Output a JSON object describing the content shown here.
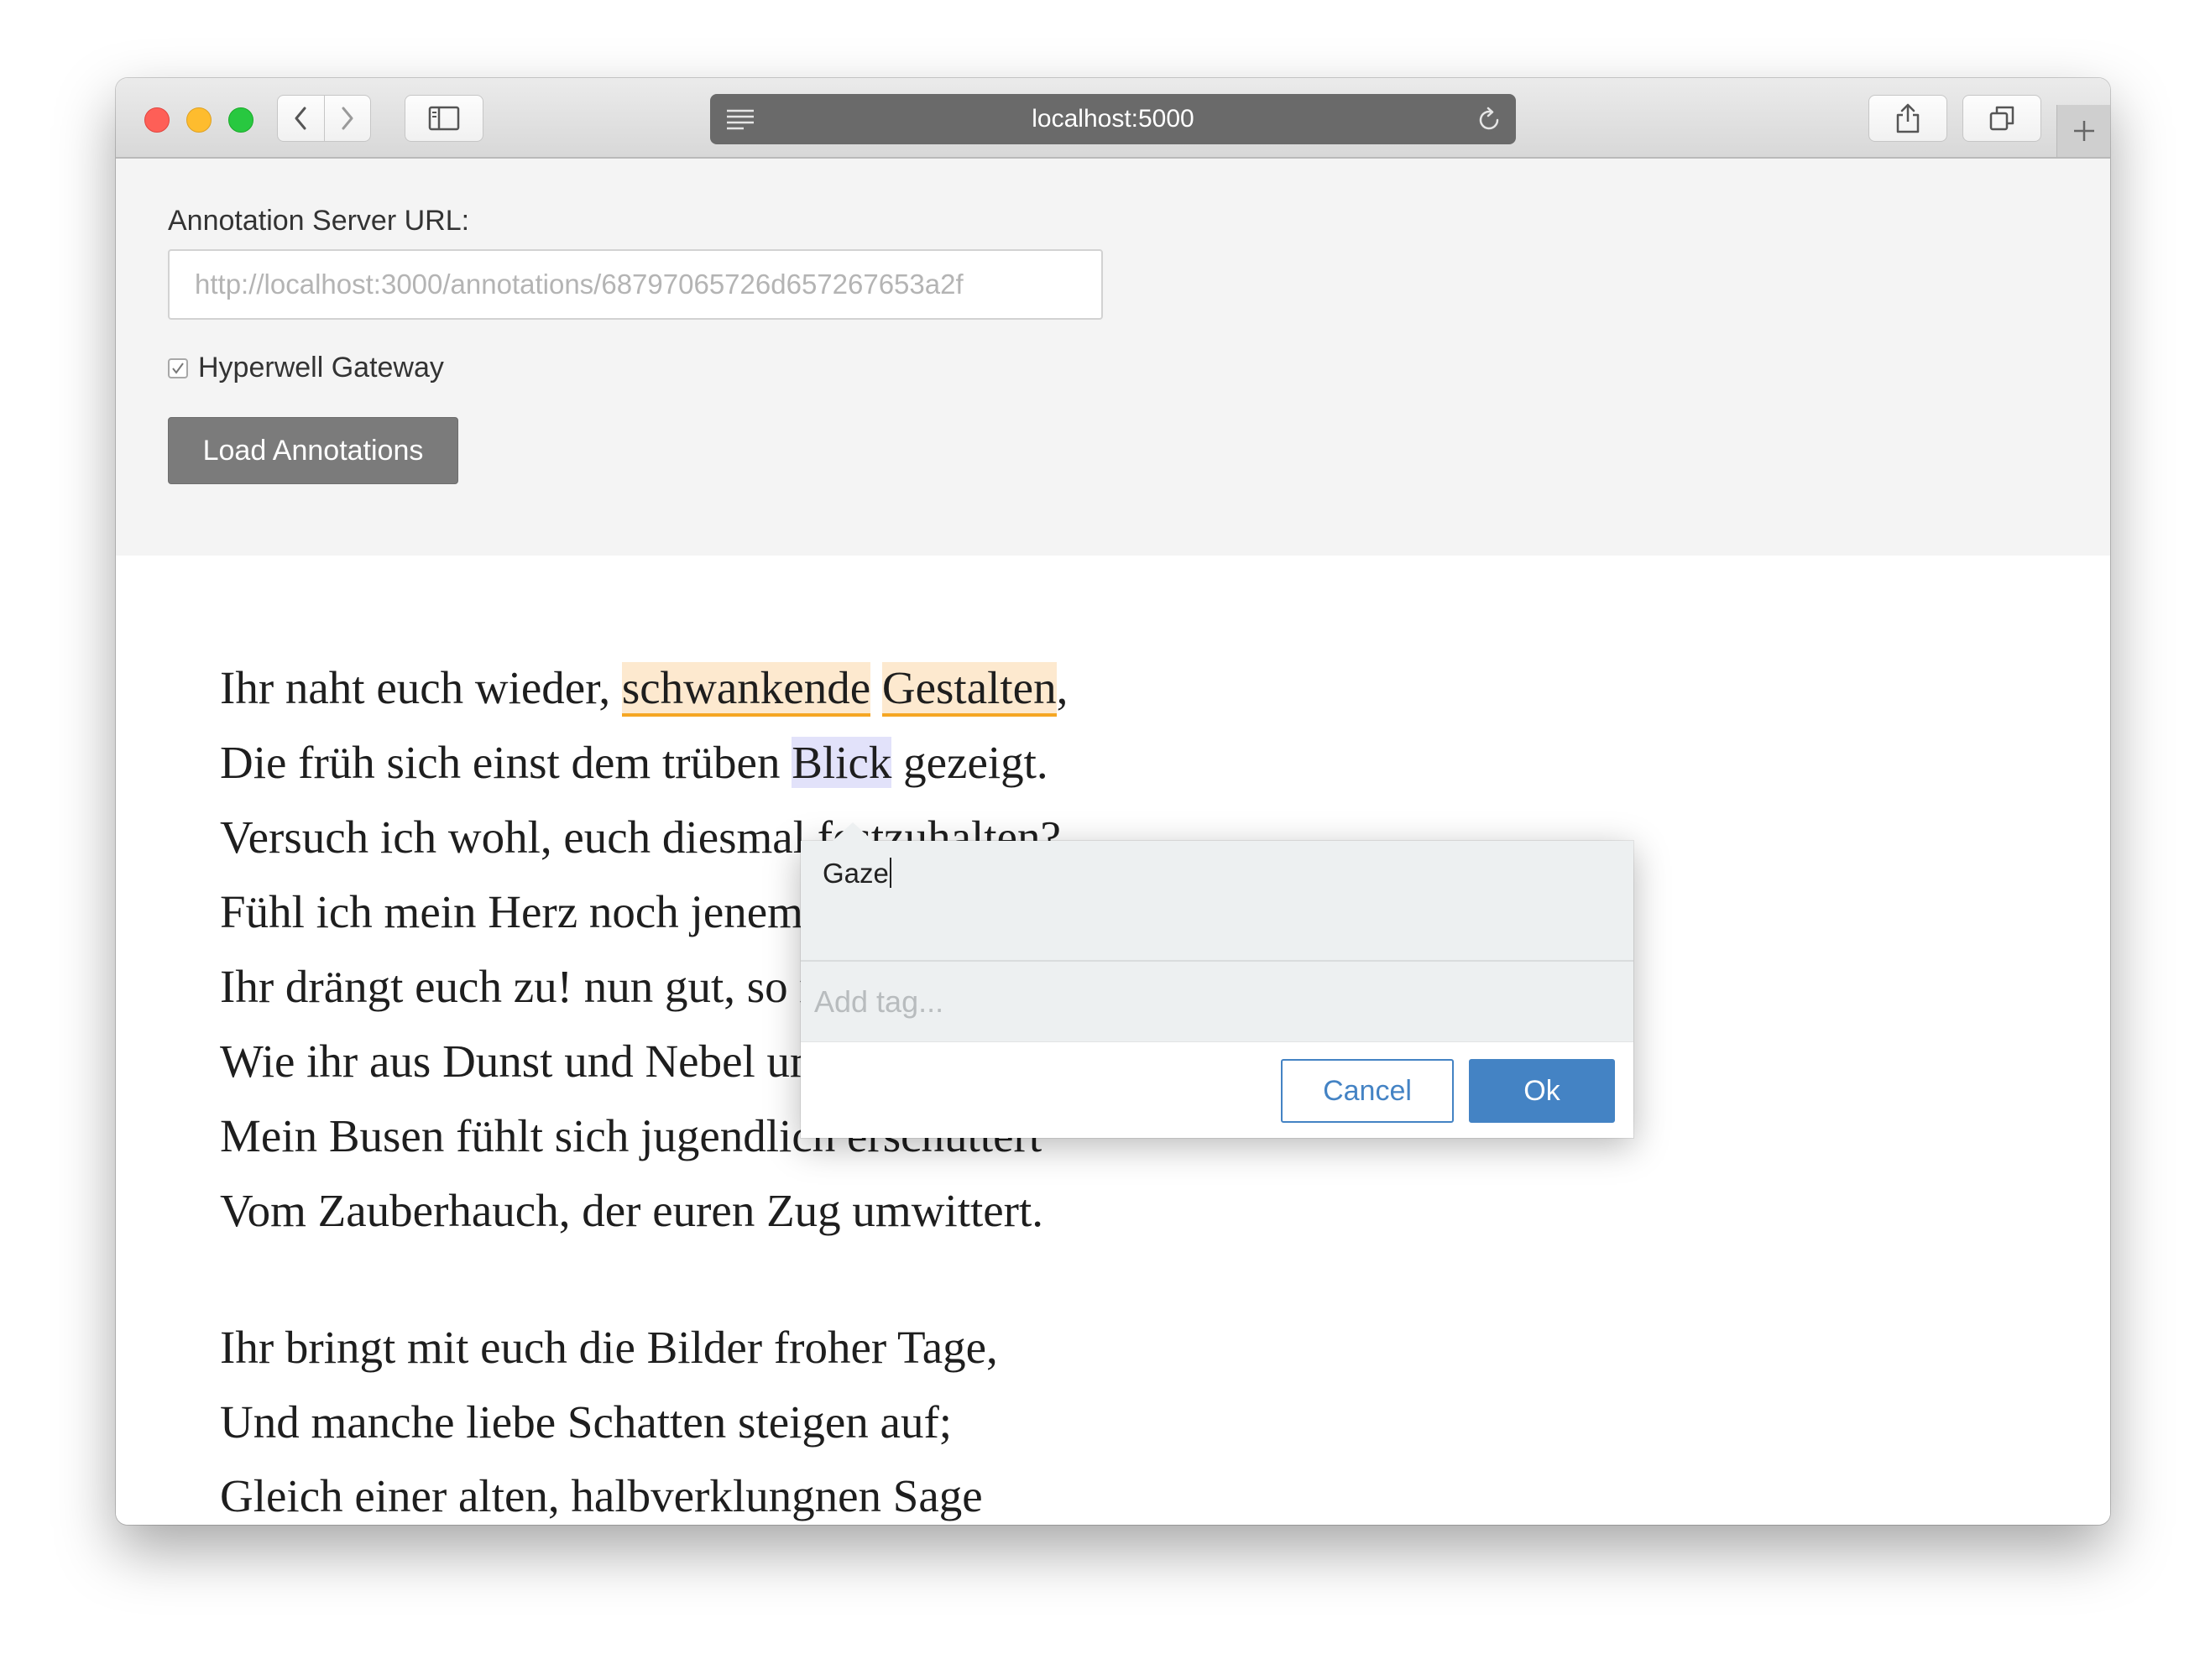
{
  "browser": {
    "address": "localhost:5000",
    "icons": {
      "back": "chevron-left-icon",
      "forward": "chevron-right-icon",
      "sidebar": "sidebar-icon",
      "reader": "reader-icon",
      "reload": "reload-icon",
      "share": "share-icon",
      "tabs": "tabs-overview-icon",
      "new_tab": "plus-icon"
    }
  },
  "settings": {
    "server_url_label": "Annotation Server URL:",
    "server_url_placeholder": "http://localhost:3000/annotations/68797065726d657267653a2f",
    "gateway_checkbox_label": "Hyperwell Gateway",
    "gateway_checked": true,
    "load_button_label": "Load Annotations"
  },
  "poem": {
    "stanza1": [
      {
        "pre": "Ihr naht euch wieder, ",
        "hl1": "schwankende",
        "mid": " ",
        "hl2": "Gestalten",
        "post": ","
      },
      {
        "pre": "Die früh sich einst dem trüben ",
        "hl": "Blick",
        "post": " gezeigt."
      },
      {
        "text": "Versuch ich wohl, euch diesmal festzuhalten?"
      },
      {
        "text": "Fühl ich mein Herz noch jenem Wahn geneigt?"
      },
      {
        "text": "Ihr drängt euch zu! nun gut, so mögt ihr walten,"
      },
      {
        "text": "Wie ihr aus Dunst und Nebel um mich steigt;"
      },
      {
        "text": "Mein Busen fühlt sich jugendlich erschüttert"
      },
      {
        "text": "Vom Zauberhauch, der euren Zug umwittert."
      }
    ],
    "stanza2": [
      {
        "text": "Ihr bringt mit euch die Bilder froher Tage,"
      },
      {
        "text": "Und manche liebe Schatten steigen auf;"
      },
      {
        "text": "Gleich einer alten, halbverklungnen Sage"
      }
    ]
  },
  "annotation_popup": {
    "comment_text": "Gaze",
    "tag_placeholder": "Add tag...",
    "cancel_label": "Cancel",
    "ok_label": "Ok"
  },
  "colors": {
    "highlight_orange": "#fde9cf",
    "highlight_orange_underline": "#f5a623",
    "highlight_blue": "#e2e2fa",
    "accent_blue": "#4483c4"
  }
}
